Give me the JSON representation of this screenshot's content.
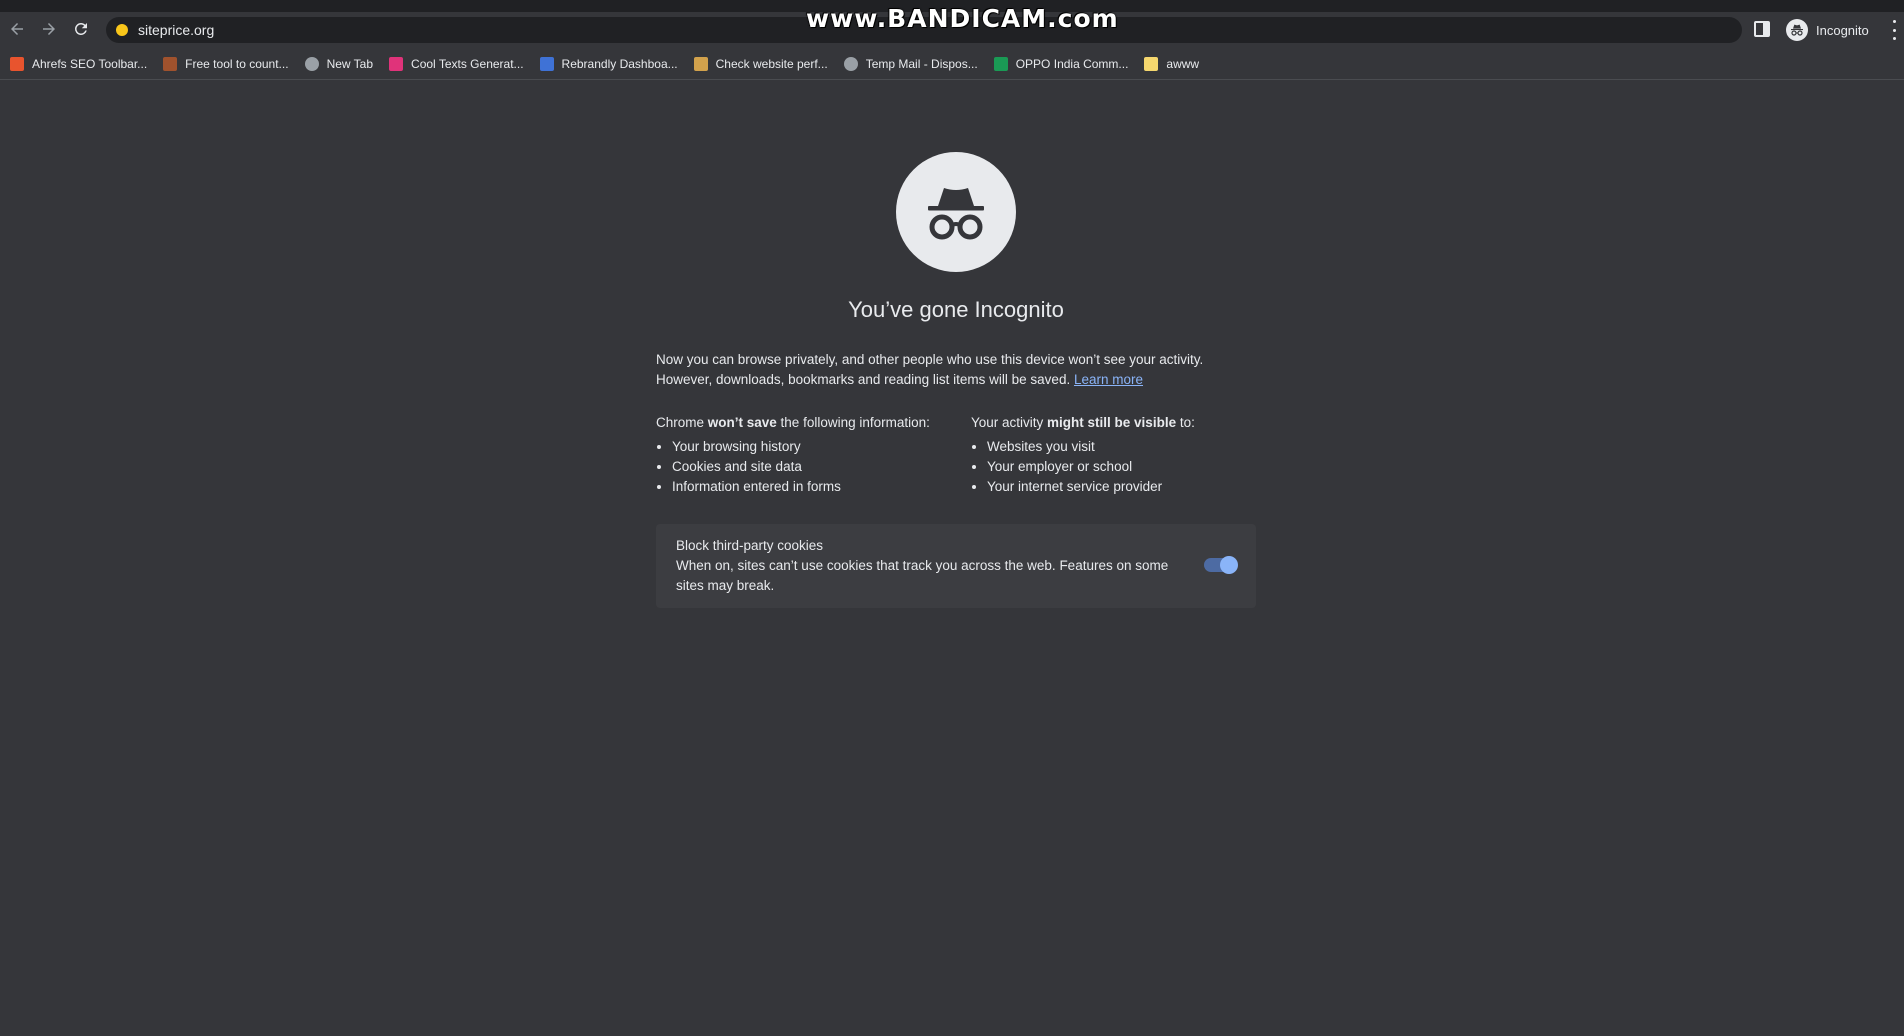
{
  "browser": {
    "url": "siteprice.org",
    "profile_label": "Incognito",
    "watermark": "www.BANDICAM.com"
  },
  "bookmarks": [
    {
      "label": "Ahrefs SEO Toolbar...",
      "icon": "ahrefs-icon",
      "color": "#e8542e"
    },
    {
      "label": "Free tool to count...",
      "icon": "page-icon",
      "color": "#a0522d"
    },
    {
      "label": "New Tab",
      "icon": "globe-icon",
      "color": "#9aa0a6"
    },
    {
      "label": "Cool Texts Generat...",
      "icon": "ct-icon",
      "color": "#e0337a"
    },
    {
      "label": "Rebrandly Dashboa...",
      "icon": "rebrandly-icon",
      "color": "#3f72d6"
    },
    {
      "label": "Check website perf...",
      "icon": "folder-icon",
      "color": "#d2a24c"
    },
    {
      "label": "Temp Mail - Dispos...",
      "icon": "globe-icon",
      "color": "#9aa0a6"
    },
    {
      "label": "OPPO India Comm...",
      "icon": "oppo-icon",
      "color": "#1a9a55"
    },
    {
      "label": "awww",
      "icon": "folder-icon",
      "color": "#f5d76e"
    }
  ],
  "page": {
    "title": "You’ve gone Incognito",
    "intro_line1": "Now you can browse privately, and other people who use this device won’t see your activity.",
    "intro_line2": "However, downloads, bookmarks and reading list items will be saved.",
    "learn_more": "Learn more",
    "left_heading_pre": "Chrome ",
    "left_heading_bold": "won’t save",
    "left_heading_post": " the following information:",
    "left_items": [
      "Your browsing history",
      "Cookies and site data",
      "Information entered in forms"
    ],
    "right_heading_pre": "Your activity ",
    "right_heading_bold": "might still be visible",
    "right_heading_post": " to:",
    "right_items": [
      "Websites you visit",
      "Your employer or school",
      "Your internet service provider"
    ],
    "cookie_title": "Block third-party cookies",
    "cookie_desc": "When on, sites can’t use cookies that track you across the web. Features on some sites may break.",
    "cookie_toggle_on": true
  }
}
